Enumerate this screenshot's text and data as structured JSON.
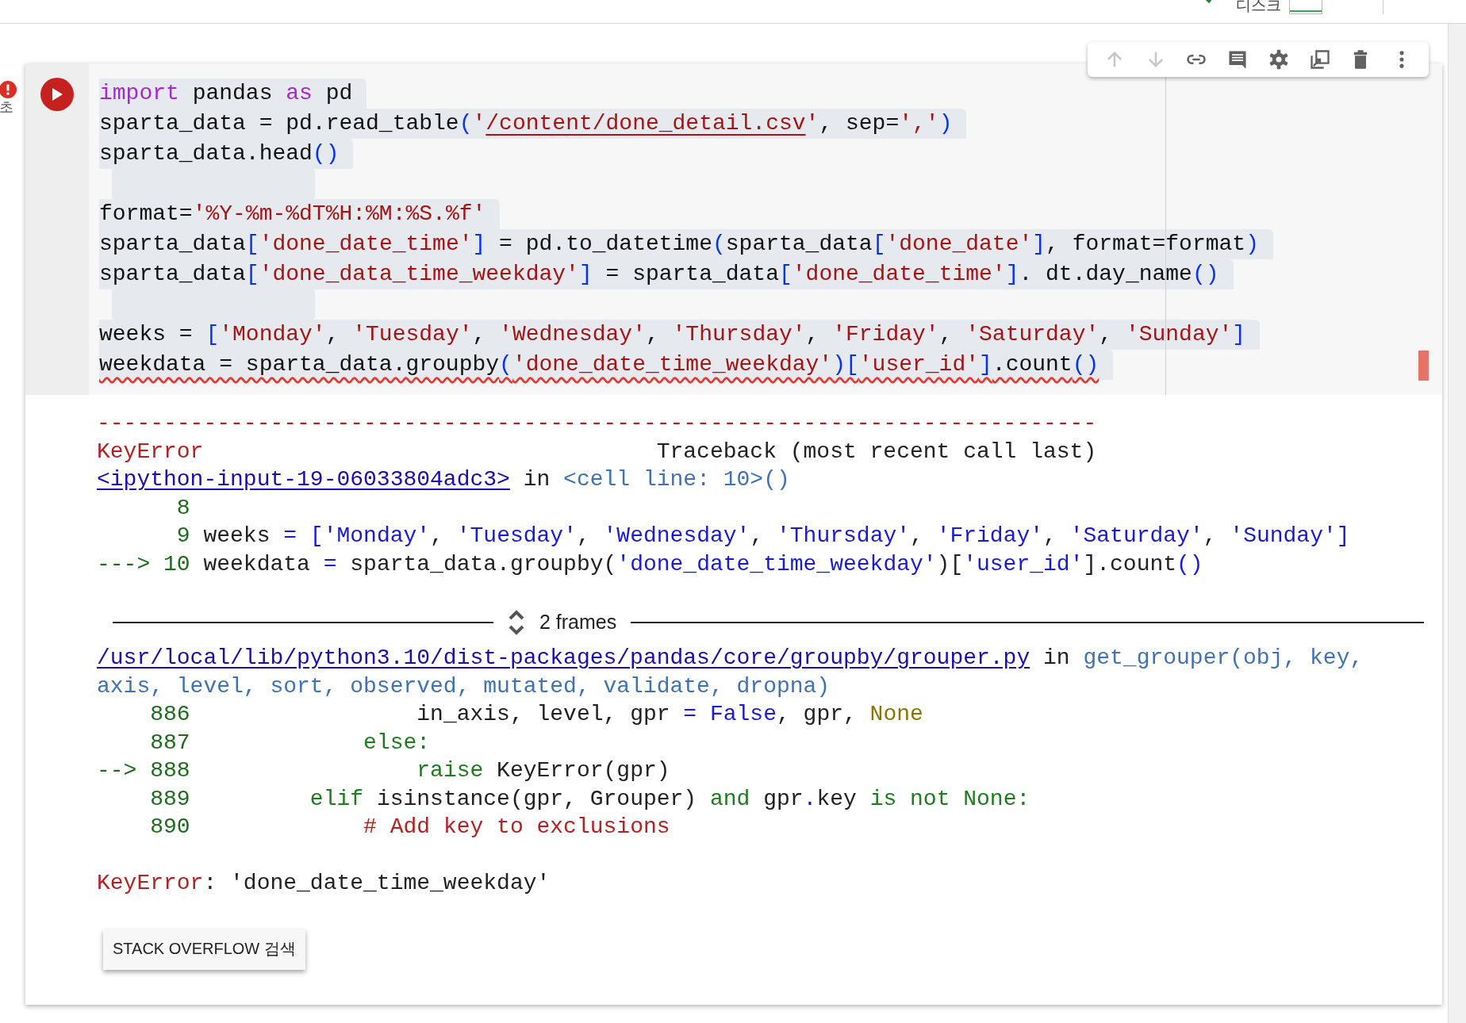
{
  "header": {
    "disk_label": "디스크"
  },
  "gutter": {
    "elapsed": "초"
  },
  "toolbar": [
    {
      "kind": "up",
      "disabled": true
    },
    {
      "kind": "down",
      "disabled": true
    },
    {
      "kind": "link",
      "disabled": false
    },
    {
      "kind": "comment",
      "disabled": false
    },
    {
      "kind": "settings",
      "disabled": false
    },
    {
      "kind": "mirror",
      "disabled": false
    },
    {
      "kind": "delete",
      "disabled": false
    },
    {
      "kind": "more",
      "disabled": false
    }
  ],
  "code_lines": [
    {
      "kind": "code",
      "tokens": [
        {
          "kind": "kw",
          "text": "import"
        },
        {
          "kind": "txt",
          "text": " pandas "
        },
        {
          "kind": "kw",
          "text": "as"
        },
        {
          "kind": "txt",
          "text": " pd"
        }
      ]
    },
    {
      "kind": "code",
      "tokens": [
        {
          "kind": "txt",
          "text": "sparta_data = pd.read_table"
        },
        {
          "kind": "br",
          "text": "("
        },
        {
          "kind": "str",
          "text": "'"
        },
        {
          "kind": "stru",
          "text": "/content/done_detail.csv"
        },
        {
          "kind": "str",
          "text": "'"
        },
        {
          "kind": "txt",
          "text": ", sep="
        },
        {
          "kind": "str",
          "text": "','"
        },
        {
          "kind": "br",
          "text": ")"
        }
      ]
    },
    {
      "kind": "code",
      "tokens": [
        {
          "kind": "txt",
          "text": "sparta_data.head"
        },
        {
          "kind": "br",
          "text": "()"
        }
      ]
    },
    {
      "kind": "blank"
    },
    {
      "kind": "code",
      "tokens": [
        {
          "kind": "txt",
          "text": "format="
        },
        {
          "kind": "str",
          "text": "'%Y-%m-%dT%H:%M:%S.%f'"
        }
      ]
    },
    {
      "kind": "code",
      "tokens": [
        {
          "kind": "txt",
          "text": "sparta_data"
        },
        {
          "kind": "br",
          "text": "["
        },
        {
          "kind": "str",
          "text": "'done_date_time'"
        },
        {
          "kind": "br",
          "text": "]"
        },
        {
          "kind": "txt",
          "text": " = pd.to_datetime"
        },
        {
          "kind": "br",
          "text": "("
        },
        {
          "kind": "txt",
          "text": "sparta_data"
        },
        {
          "kind": "br",
          "text": "["
        },
        {
          "kind": "str",
          "text": "'done_date'"
        },
        {
          "kind": "br",
          "text": "]"
        },
        {
          "kind": "txt",
          "text": ", format=format"
        },
        {
          "kind": "br",
          "text": ")"
        }
      ]
    },
    {
      "kind": "code",
      "tokens": [
        {
          "kind": "txt",
          "text": "sparta_data"
        },
        {
          "kind": "br",
          "text": "["
        },
        {
          "kind": "str",
          "text": "'done_data_time_weekday'"
        },
        {
          "kind": "br",
          "text": "]"
        },
        {
          "kind": "txt",
          "text": " = sparta_data"
        },
        {
          "kind": "br",
          "text": "["
        },
        {
          "kind": "str",
          "text": "'done_date_time'"
        },
        {
          "kind": "br",
          "text": "]"
        },
        {
          "kind": "txt",
          "text": ". dt.day_name"
        },
        {
          "kind": "br",
          "text": "()"
        }
      ]
    },
    {
      "kind": "blank"
    },
    {
      "kind": "code",
      "tokens": [
        {
          "kind": "txt",
          "text": "weeks = "
        },
        {
          "kind": "br",
          "text": "["
        },
        {
          "kind": "str",
          "text": "'Monday'"
        },
        {
          "kind": "txt",
          "text": ", "
        },
        {
          "kind": "str",
          "text": "'Tuesday'"
        },
        {
          "kind": "txt",
          "text": ", "
        },
        {
          "kind": "str",
          "text": "'Wednesday'"
        },
        {
          "kind": "txt",
          "text": ", "
        },
        {
          "kind": "str",
          "text": "'Thursday'"
        },
        {
          "kind": "txt",
          "text": ", "
        },
        {
          "kind": "str",
          "text": "'Friday'"
        },
        {
          "kind": "txt",
          "text": ", "
        },
        {
          "kind": "str",
          "text": "'Saturday'"
        },
        {
          "kind": "txt",
          "text": ", "
        },
        {
          "kind": "str",
          "text": "'Sunday'"
        },
        {
          "kind": "br",
          "text": "]"
        }
      ]
    },
    {
      "kind": "flagged",
      "tokens": [
        {
          "kind": "txt",
          "text": "weekdata = sparta_data.groupby"
        },
        {
          "kind": "br",
          "text": "("
        },
        {
          "kind": "str",
          "text": "'done_date_time_weekday'"
        },
        {
          "kind": "br",
          "text": ")["
        },
        {
          "kind": "str",
          "text": "'user_id'"
        },
        {
          "kind": "br",
          "text": "]"
        },
        {
          "kind": "txt",
          "text": ".count"
        },
        {
          "kind": "br",
          "text": "()"
        }
      ]
    }
  ],
  "traceback": {
    "head_lines": [
      [
        {
          "kind": "err",
          "text": "---------------------------------------------------------------------------"
        }
      ],
      [
        {
          "kind": "err",
          "text": "KeyError"
        },
        {
          "kind": "txt",
          "text": "                                  Traceback (most recent call last)"
        }
      ],
      [
        {
          "kind": "link",
          "text": "<ipython-input-19-06033804adc3>"
        },
        {
          "kind": "txt",
          "text": " in "
        },
        {
          "kind": "fn",
          "text": "<cell line: 10>()"
        }
      ],
      [
        {
          "kind": "num",
          "text": "      8"
        }
      ],
      [
        {
          "kind": "num",
          "text": "      9"
        },
        {
          "kind": "txt",
          "text": " weeks "
        },
        {
          "kind": "op",
          "text": "= ["
        },
        {
          "kind": "tstr",
          "text": "'Monday'"
        },
        {
          "kind": "txt",
          "text": ", "
        },
        {
          "kind": "tstr",
          "text": "'Tuesday'"
        },
        {
          "kind": "txt",
          "text": ", "
        },
        {
          "kind": "tstr",
          "text": "'Wednesday'"
        },
        {
          "kind": "txt",
          "text": ", "
        },
        {
          "kind": "tstr",
          "text": "'Thursday'"
        },
        {
          "kind": "txt",
          "text": ", "
        },
        {
          "kind": "tstr",
          "text": "'Friday'"
        },
        {
          "kind": "txt",
          "text": ", "
        },
        {
          "kind": "tstr",
          "text": "'Saturday'"
        },
        {
          "kind": "txt",
          "text": ", "
        },
        {
          "kind": "tstr",
          "text": "'Sunday'"
        },
        {
          "kind": "op",
          "text": "]"
        }
      ],
      [
        {
          "kind": "num",
          "text": "---> 10"
        },
        {
          "kind": "txt",
          "text": " weekdata "
        },
        {
          "kind": "op",
          "text": "="
        },
        {
          "kind": "txt",
          "text": " sparta_data.groupby("
        },
        {
          "kind": "tstr",
          "text": "'done_date_time_weekday'"
        },
        {
          "kind": "txt",
          "text": ")["
        },
        {
          "kind": "tstr",
          "text": "'user_id'"
        },
        {
          "kind": "txt",
          "text": "].count"
        },
        {
          "kind": "op",
          "text": "()"
        }
      ]
    ],
    "frames_label": "2 frames",
    "frame_lines": [
      [
        {
          "kind": "link",
          "text": "/usr/local/lib/python3.10/dist-packages/pandas/core/groupby/grouper.py"
        },
        {
          "kind": "txt",
          "text": " in "
        },
        {
          "kind": "fn",
          "text": "get_grouper(obj, key,"
        }
      ],
      [
        {
          "kind": "fn",
          "text": "axis, level, sort, observed, mutated, validate, dropna)"
        }
      ],
      [
        {
          "kind": "num",
          "text": "    886"
        },
        {
          "kind": "txt",
          "text": "                 in_axis, level, gpr "
        },
        {
          "kind": "op",
          "text": "= False"
        },
        {
          "kind": "txt",
          "text": ", gpr, "
        },
        {
          "kind": "none",
          "text": "None"
        }
      ],
      [
        {
          "kind": "num",
          "text": "    887"
        },
        {
          "kind": "kw",
          "text": "             else:"
        }
      ],
      [
        {
          "kind": "num",
          "text": "--> 888"
        },
        {
          "kind": "kw",
          "text": "                 raise"
        },
        {
          "kind": "txt",
          "text": " KeyError(gpr)"
        }
      ],
      [
        {
          "kind": "num",
          "text": "    889"
        },
        {
          "kind": "kw",
          "text": "         elif"
        },
        {
          "kind": "txt",
          "text": " isinstance(gpr, Grouper) "
        },
        {
          "kind": "kw",
          "text": "and"
        },
        {
          "kind": "txt",
          "text": " gpr"
        },
        {
          "kind": "op",
          "text": "."
        },
        {
          "kind": "txt",
          "text": "key "
        },
        {
          "kind": "kw",
          "text": "is not None:"
        }
      ],
      [
        {
          "kind": "num",
          "text": "    890"
        },
        {
          "kind": "cmt",
          "text": "             # Add key to exclusions"
        }
      ]
    ],
    "error_line": [
      {
        "kind": "err",
        "text": "KeyError"
      },
      {
        "kind": "txt",
        "text": ": 'done_date_time_weekday'"
      }
    ]
  },
  "search_button": "STACK OVERFLOW 검색"
}
